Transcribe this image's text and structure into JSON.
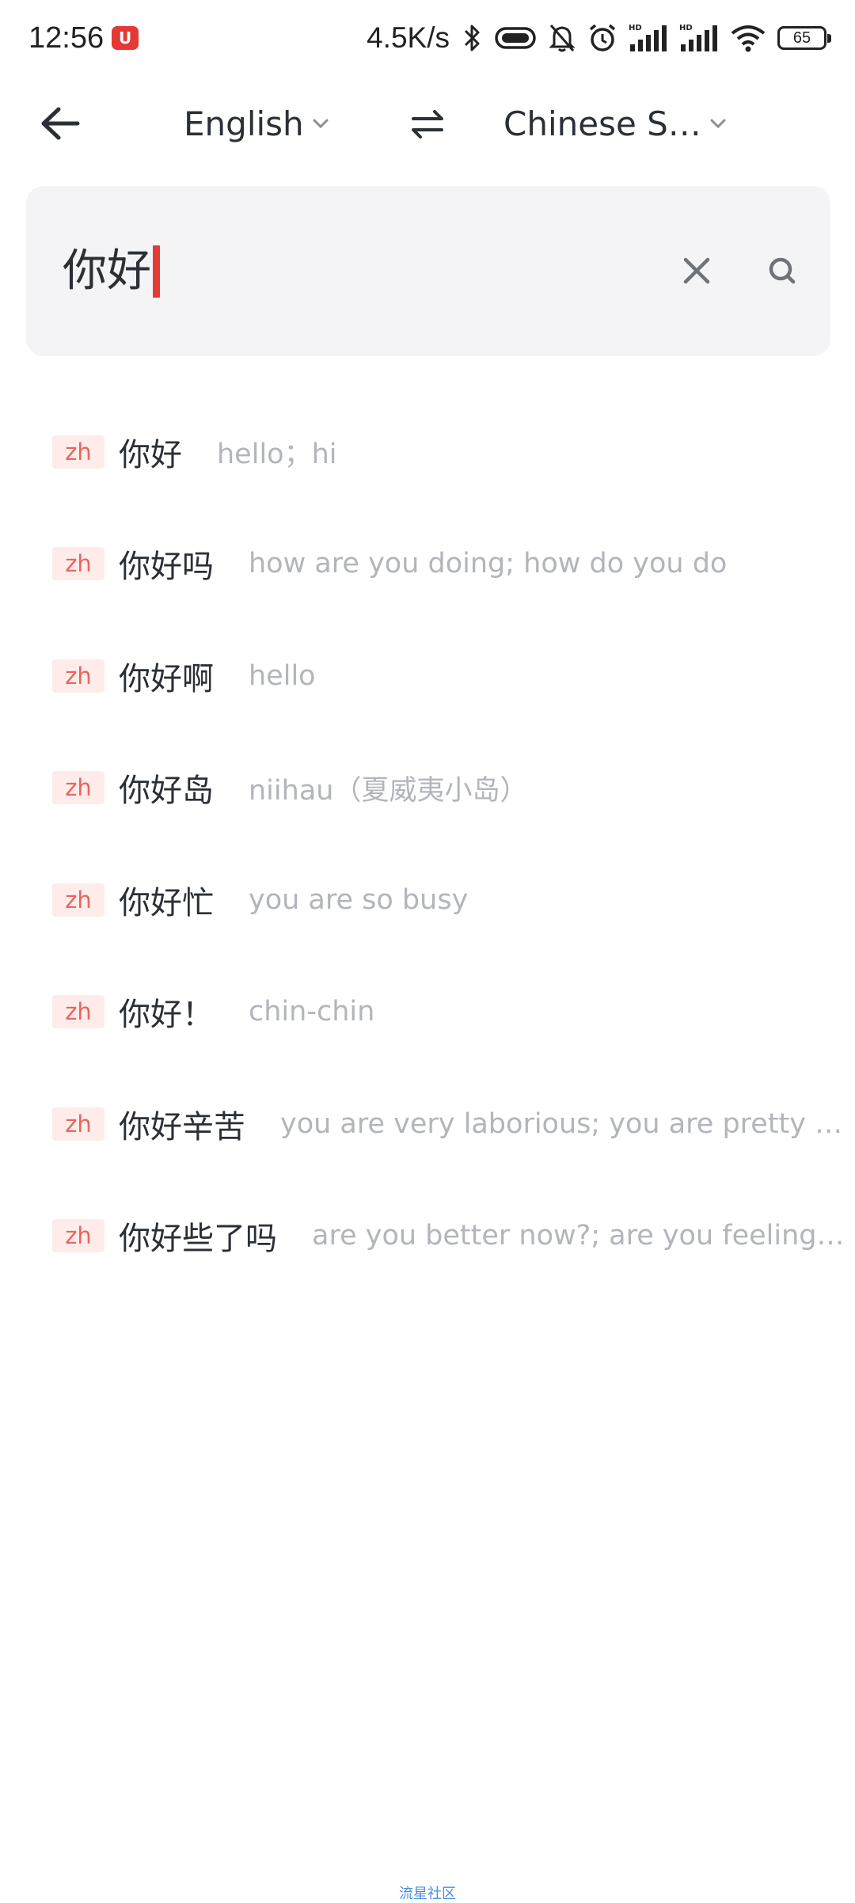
{
  "status_bar": {
    "time": "12:56",
    "app_badge": "U",
    "network_speed": "4.5K/s",
    "battery": "65",
    "icons": [
      "bluetooth-icon",
      "vibrate-icon",
      "mute-bell-icon",
      "alarm-icon",
      "signal-hd-icon",
      "signal-hd-icon",
      "wifi-icon",
      "battery-icon"
    ]
  },
  "header": {
    "source_language": "English",
    "target_language": "Chinese S…"
  },
  "search": {
    "value": "你好"
  },
  "suggestions": [
    {
      "tag": "zh",
      "word": "你好",
      "meaning": "hello；hi"
    },
    {
      "tag": "zh",
      "word": "你好吗",
      "meaning": "how are you doing; how do you do"
    },
    {
      "tag": "zh",
      "word": "你好啊",
      "meaning": "hello"
    },
    {
      "tag": "zh",
      "word": "你好岛",
      "meaning": "niihau（夏威夷小岛）"
    },
    {
      "tag": "zh",
      "word": "你好忙",
      "meaning": "you are so busy"
    },
    {
      "tag": "zh",
      "word": "你好！",
      "meaning": "chin-chin"
    },
    {
      "tag": "zh",
      "word": "你好辛苦",
      "meaning": "you are very laborious; you are pretty h…"
    },
    {
      "tag": "zh",
      "word": "你好些了吗",
      "meaning": "are you better now?; are you feeling…"
    }
  ],
  "footer": {
    "watermark": "流星社区"
  },
  "colors": {
    "accent": "#e53935",
    "tag_bg": "#fdecea",
    "tag_text": "#e5675d",
    "meaning_text": "#b2b5bb",
    "search_bg": "#f4f4f6"
  }
}
